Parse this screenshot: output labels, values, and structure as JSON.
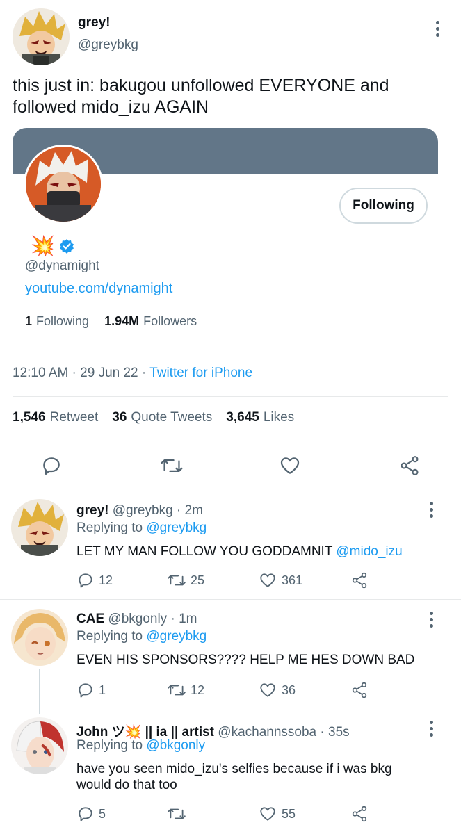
{
  "main_tweet": {
    "display_name": "grey!",
    "handle": "@greybkg",
    "text": "this just in: bakugou unfollowed EVERYONE and followed mido_izu AGAIN",
    "timestamp": "12:10 AM · 29 Jun 22 · ",
    "source": "Twitter for iPhone",
    "retweets_count": "1,546",
    "retweets_label": "Retweet",
    "quotes_count": "36",
    "quotes_label": "Quote Tweets",
    "likes_count": "3,645",
    "likes_label": "Likes"
  },
  "profile_card": {
    "name_emoji": "💥",
    "handle": "@dynamight",
    "link": "youtube.com/dynamight",
    "following_count": "1",
    "following_label": "Following",
    "followers_count": "1.94M",
    "followers_label": "Followers",
    "follow_button": "Following",
    "banner_color": "#627688"
  },
  "replies": [
    {
      "name": "grey!",
      "handle_time": "@greybkg · 2m",
      "replying_label": "Replying to ",
      "replying_to": "@greybkg",
      "text": "LET MY MAN FOLLOW YOU GODDAMNIT ",
      "mention": "@mido_izu",
      "replies": "12",
      "retweets": "25",
      "likes": "361"
    },
    {
      "name": "CAE",
      "handle_time": "@bkgonly · 1m",
      "replying_label": "Replying to ",
      "replying_to": "@greybkg",
      "text": "EVEN HIS SPONSORS???? HELP ME HES DOWN BAD",
      "replies": "1",
      "retweets": "12",
      "likes": "36"
    },
    {
      "name": "John ツ💥 || ia || artist",
      "handle_time": "@kachannssoba · 35s",
      "replying_label": "Replying to ",
      "replying_to": "@bkgonly",
      "text": "have you seen mido_izu's selfies because if i was bkg would do that too",
      "replies": "5",
      "retweets": "",
      "likes": "55"
    }
  ],
  "colors": {
    "accent": "#1d9bf0",
    "secondary_text": "#536471",
    "divider": "#e7e9ea"
  }
}
